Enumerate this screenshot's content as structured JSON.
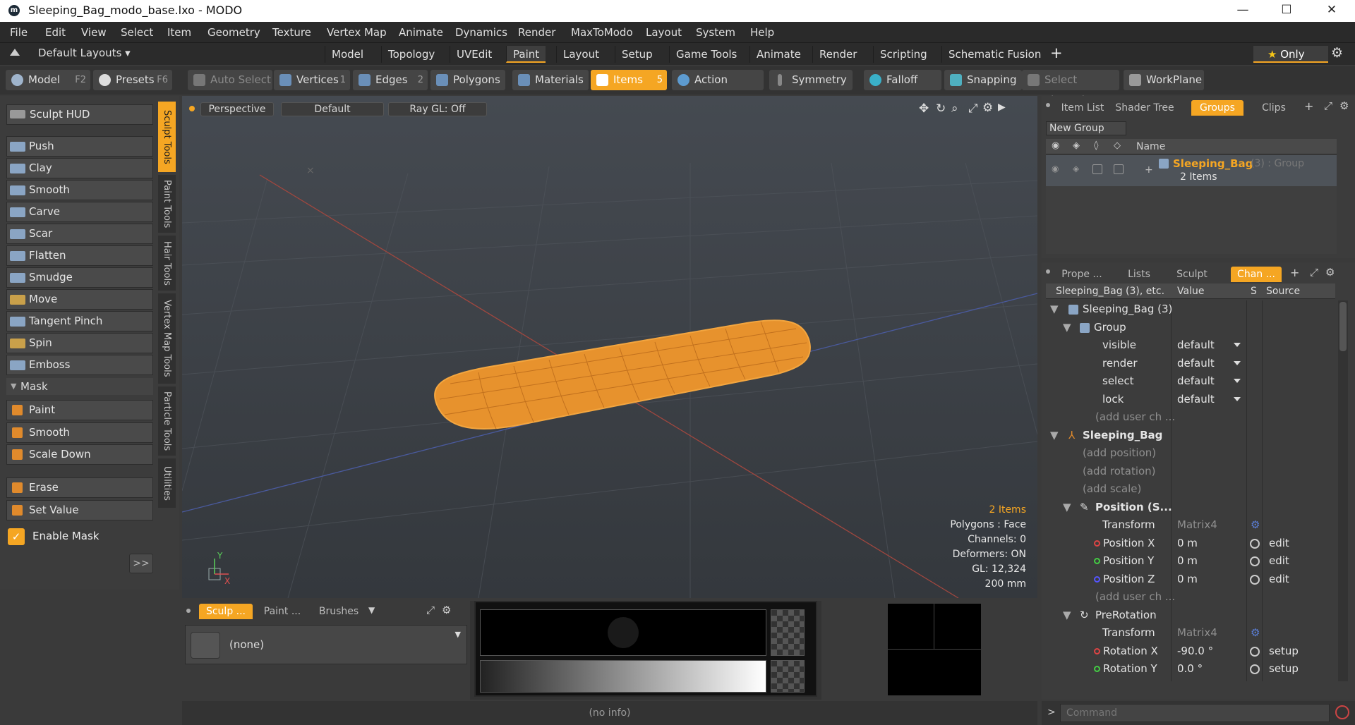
{
  "window": {
    "title": "Sleeping_Bag_modo_base.lxo - MODO",
    "logo": "modo-logo-icon"
  },
  "menu": [
    "File",
    "Edit",
    "View",
    "Select",
    "Item",
    "Geometry",
    "Texture",
    "Vertex Map",
    "Animate",
    "Dynamics",
    "Render",
    "MaxToModo",
    "Layout",
    "System",
    "Help"
  ],
  "layouts": {
    "label": "Default Layouts",
    "tabs": [
      "Model",
      "Topology",
      "UVEdit",
      "Paint",
      "Layout",
      "Setup",
      "Game Tools",
      "Animate",
      "Render",
      "Scripting",
      "Schematic Fusion"
    ],
    "active": "Paint",
    "only": "Only"
  },
  "toolbar": {
    "model": "Model",
    "model_key": "F2",
    "presets": "Presets",
    "presets_key": "F6",
    "auto_select": "Auto Select",
    "vertices": "Vertices",
    "vertices_n": "1",
    "edges": "Edges",
    "edges_n": "2",
    "polygons": "Polygons",
    "materials": "Materials",
    "items": "Items",
    "items_n": "5",
    "action_center": "Action Center",
    "symmetry": "Symmetry",
    "falloff": "Falloff",
    "snapping": "Snapping",
    "select_through": "Select Through",
    "workplane": "WorkPlane"
  },
  "sculpt": {
    "hud": "Sculpt HUD",
    "tools": [
      "Push",
      "Clay",
      "Smooth",
      "Carve",
      "Scar",
      "Flatten",
      "Smudge",
      "Move",
      "Tangent Pinch",
      "Spin",
      "Emboss"
    ],
    "mask_label": "Mask",
    "mask_tools": [
      "Paint",
      "Smooth",
      "Scale Down"
    ],
    "erase": "Erase",
    "set_value": "Set Value",
    "enable_mask": "Enable Mask",
    "more": ">>"
  },
  "vtabs": [
    "Sculpt Tools",
    "Paint Tools",
    "Hair Tools",
    "Vertex Map Tools",
    "Particle Tools",
    "Utilities"
  ],
  "viewport": {
    "view": "Perspective",
    "shading": "Default",
    "raygl": "Ray GL: Off",
    "info": [
      "2 Items",
      "Polygons : Face",
      "Channels: 0",
      "Deformers: ON",
      "GL: 12,324",
      "200 mm"
    ]
  },
  "bottom": {
    "tabs": [
      "Sculp ...",
      "Paint ...",
      "Brushes"
    ],
    "none": "(none)"
  },
  "status": "(no info)",
  "groups": {
    "tabs": [
      "Item List",
      "Shader Tree",
      "Groups",
      "Clips"
    ],
    "new_group": "New Group",
    "name_col": "Name",
    "item": "Sleeping_Bag",
    "item_suffix": "(3) : Group",
    "item_count": "2 Items"
  },
  "channels": {
    "tabs": [
      "Prope ...",
      "Lists",
      "Sculpt",
      "Chan ..."
    ],
    "header": [
      "Sleeping_Bag (3), etc.",
      "Value",
      "S",
      "Source"
    ],
    "rows": [
      {
        "name": "Sleeping_Bag (3)",
        "value": "",
        "src": ""
      },
      {
        "name": "Group",
        "value": "",
        "src": ""
      },
      {
        "name": "visible",
        "value": "default",
        "src": ""
      },
      {
        "name": "render",
        "value": "default",
        "src": ""
      },
      {
        "name": "select",
        "value": "default",
        "src": ""
      },
      {
        "name": "lock",
        "value": "default",
        "src": ""
      },
      {
        "name": "(add user ch ...",
        "value": "",
        "src": ""
      },
      {
        "name": "Sleeping_Bag",
        "value": "",
        "src": ""
      },
      {
        "name": "(add position)",
        "value": "",
        "src": ""
      },
      {
        "name": "(add rotation)",
        "value": "",
        "src": ""
      },
      {
        "name": "(add scale)",
        "value": "",
        "src": ""
      },
      {
        "name": "Position (S...",
        "value": "",
        "src": ""
      },
      {
        "name": "Transform",
        "value": "Matrix4",
        "src": ""
      },
      {
        "name": "Position X",
        "value": "0 m",
        "src": "edit"
      },
      {
        "name": "Position Y",
        "value": "0 m",
        "src": "edit"
      },
      {
        "name": "Position Z",
        "value": "0 m",
        "src": "edit"
      },
      {
        "name": "(add user ch ...",
        "value": "",
        "src": ""
      },
      {
        "name": "PreRotation",
        "value": "",
        "src": ""
      },
      {
        "name": "Transform",
        "value": "Matrix4",
        "src": ""
      },
      {
        "name": "Rotation X",
        "value": "-90.0 °",
        "src": "setup"
      },
      {
        "name": "Rotation Y",
        "value": "0.0 °",
        "src": "setup"
      }
    ]
  },
  "command": {
    "placeholder": "Command"
  },
  "colors": {
    "accent": "#f5a623"
  }
}
